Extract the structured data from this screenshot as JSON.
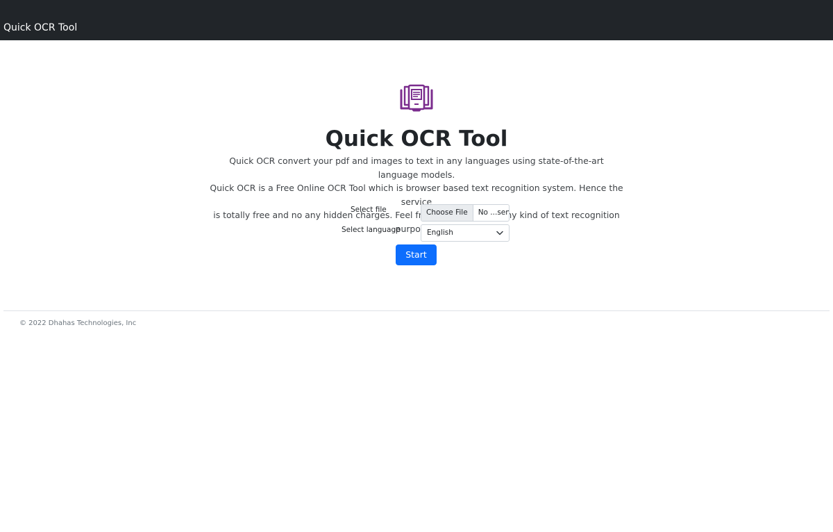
{
  "navbar": {
    "brand": "Quick OCR Tool"
  },
  "hero": {
    "logo_icon": "ocr-book-scan-icon",
    "logo_color": "#7b2d8e",
    "title": "Quick OCR Tool",
    "description_lines": [
      "Quick OCR convert your pdf and images to text in any languages using state-of-the-art language models.",
      "Quick OCR is a Free Online OCR Tool which is browser based text recognition system. Hence the service",
      "is totally free and no any hidden charges. Feel free to use for your any kind of text recognition purposes."
    ]
  },
  "form": {
    "file_label": "Select file",
    "file_button": "Choose File",
    "file_status": "No ...sen",
    "language_label": "Select language",
    "language_value": "English",
    "language_icon": "chevron-down-icon",
    "start_button": "Start",
    "accent_color": "#0d6efd"
  },
  "footer": {
    "copyright": "© 2022 Dhahas Technologies, Inc"
  }
}
